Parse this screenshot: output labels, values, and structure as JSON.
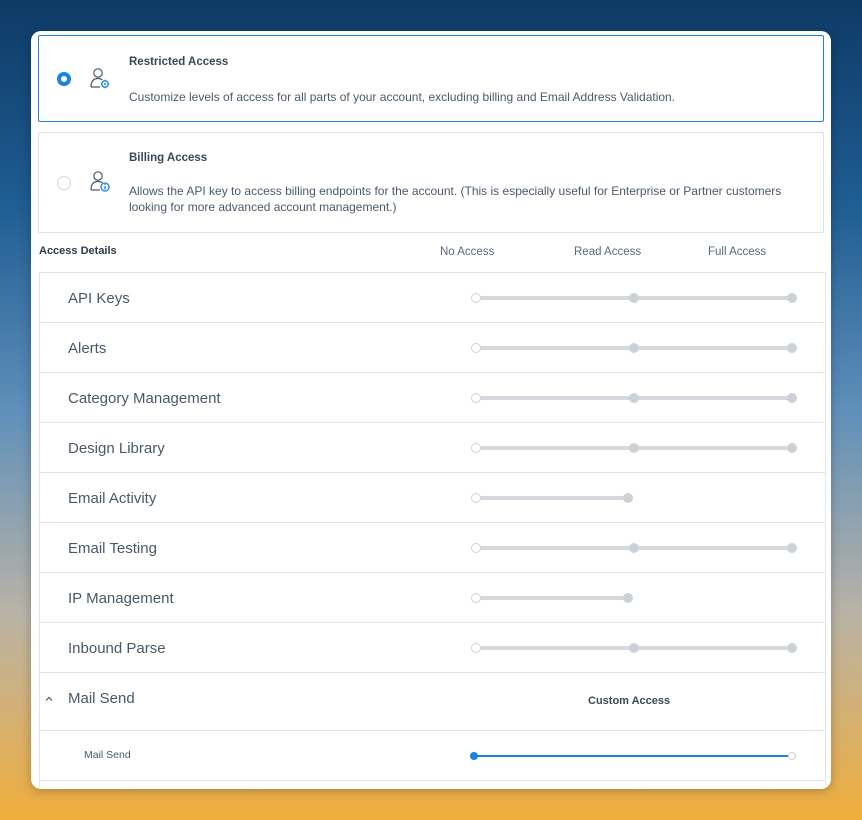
{
  "options": [
    {
      "title": "Restricted Access",
      "description": "Customize levels of access for all parts of your account, excluding billing and Email Address Validation.",
      "selected": true
    },
    {
      "title": "Billing Access",
      "description": "Allows the API key to access billing endpoints for the account. (This is especially useful for Enterprise or Partner customers looking for more advanced account management.)",
      "selected": false
    }
  ],
  "details": {
    "label": "Access Details",
    "columns": [
      "No Access",
      "Read Access",
      "Full Access"
    ]
  },
  "rows": [
    {
      "label": "API Keys",
      "levels": 3,
      "value": "No Access"
    },
    {
      "label": "Alerts",
      "levels": 3,
      "value": "No Access"
    },
    {
      "label": "Category Management",
      "levels": 3,
      "value": "No Access"
    },
    {
      "label": "Design Library",
      "levels": 3,
      "value": "No Access"
    },
    {
      "label": "Email Activity",
      "levels": 2,
      "value": "No Access"
    },
    {
      "label": "Email Testing",
      "levels": 3,
      "value": "No Access"
    },
    {
      "label": "IP Management",
      "levels": 2,
      "value": "No Access"
    },
    {
      "label": "Inbound Parse",
      "levels": 3,
      "value": "No Access"
    }
  ],
  "mail_send": {
    "label": "Mail Send",
    "status": "Custom Access",
    "sub_items": [
      {
        "label": "Mail Send",
        "value": "No Access"
      }
    ]
  },
  "colors": {
    "accent": "#1a82e2",
    "track": "#d5d9dd",
    "border": "#e2e5e9"
  }
}
